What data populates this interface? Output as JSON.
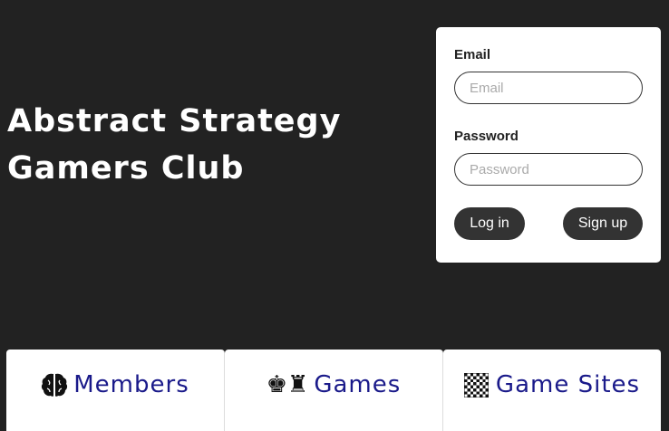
{
  "hero": {
    "title_line1": "Abstract Strategy",
    "title_line2": "Gamers Club"
  },
  "login": {
    "email_label": "Email",
    "email_placeholder": "Email",
    "email_value": "",
    "password_label": "Password",
    "password_placeholder": "Password",
    "password_value": "",
    "login_button": "Log in",
    "signup_button": "Sign up"
  },
  "nav": {
    "tiles": [
      {
        "label": "Members",
        "icon": "brain-icon"
      },
      {
        "label": "Games",
        "icon": "chess-pieces-icon"
      },
      {
        "label": "Game Sites",
        "icon": "checkerboard-icon"
      }
    ]
  },
  "colors": {
    "background": "#222222",
    "card": "#ffffff",
    "button": "#333333",
    "nav_text": "#1a1a8a"
  }
}
